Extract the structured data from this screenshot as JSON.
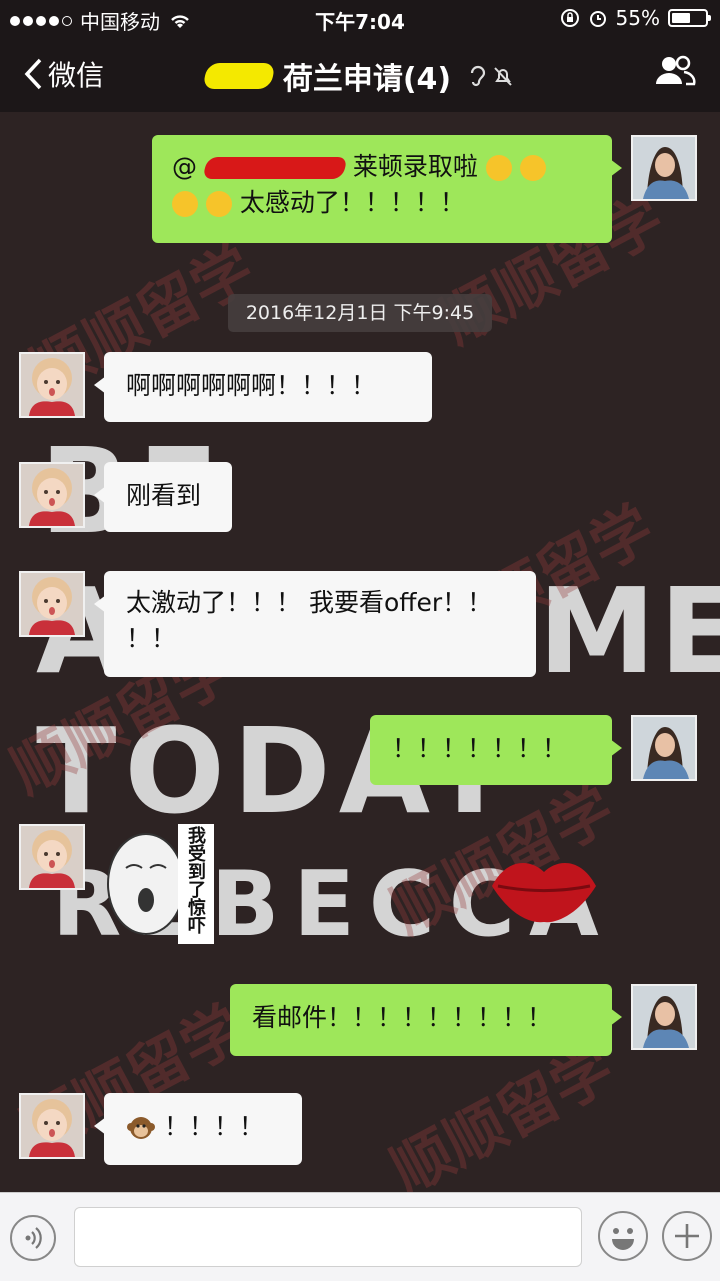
{
  "status_bar": {
    "carrier": "中国移动",
    "time": "下午7:04",
    "battery": "55%",
    "battery_level": 0.55
  },
  "nav": {
    "back_label": "微信",
    "title": "荷兰申请(4)"
  },
  "background": {
    "line1": "BE",
    "line2": "AWESOME",
    "line3": "TODAY",
    "line4": "REBECCA",
    "watermark": "顺顺留学"
  },
  "messages": [
    {
      "side": "right",
      "prefix": "@",
      "text": "莱顿录取啦",
      "text2": "太感动了！！！！！"
    },
    {
      "side": "time",
      "text": "2016年12月1日 下午9:45"
    },
    {
      "side": "left",
      "text": "啊啊啊啊啊啊！！！！"
    },
    {
      "side": "left",
      "text": "刚看到"
    },
    {
      "side": "left",
      "text": "太激动了！！！ 我要看offer！！",
      "text2": "！！"
    },
    {
      "side": "right",
      "text": "！！！！！！！"
    },
    {
      "side": "left",
      "sticker_caption": "我受到了惊吓"
    },
    {
      "side": "right",
      "text": "看邮件！！！！！！！！！"
    },
    {
      "side": "left",
      "text": "！！！！",
      "emoji": "monkey-icon"
    }
  ],
  "colors": {
    "green_bubble": "#9ee75a",
    "white_bubble": "#f7f7f7",
    "bar": "#1c1718"
  }
}
